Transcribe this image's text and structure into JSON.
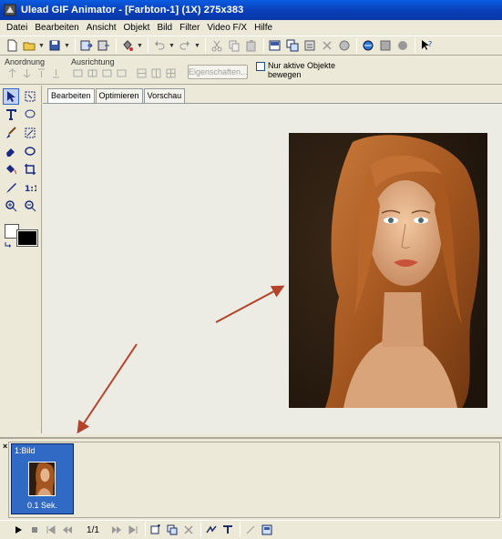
{
  "window": {
    "title": "Ulead GIF Animator - [Farbton-1] (1X) 275x383",
    "icon": "app-icon"
  },
  "menu": [
    "Datei",
    "Bearbeiten",
    "Ansicht",
    "Objekt",
    "Bild",
    "Filter",
    "Video F/X",
    "Hilfe"
  ],
  "attributes": {
    "anordnung_label": "Anordnung",
    "ausrichtung_label": "Ausrichtung",
    "eigenschaften_label": "Eigenschaften...",
    "checkbox_label": "Nur aktive Objekte bewegen",
    "checkbox_checked": false
  },
  "tabs": [
    "Bearbeiten",
    "Optimieren",
    "Vorschau"
  ],
  "active_tab": "Bearbeiten",
  "frames": [
    {
      "label": "1:Bild",
      "delay": "0.1 Sek.",
      "selected": true
    }
  ],
  "playback": {
    "counter": "1/1"
  },
  "colors": {
    "titlebar": "#0a3fb8",
    "selection": "#316ac5",
    "chrome": "#ece9d8",
    "annotation_arrow": "#b5432a",
    "foreground_swatch": "#ffffff",
    "background_swatch": "#000000"
  }
}
